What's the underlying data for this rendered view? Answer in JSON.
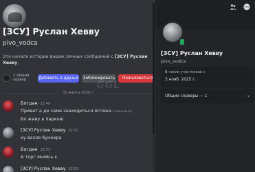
{
  "chat": {
    "title": "[ЗСУ] Руслан Хевву",
    "username": "pivo_vodca",
    "intro_prefix": "Это начало истории ваших личных сообщений с ",
    "intro_name": "[ЗСУ] Руслан Хевву",
    "intro_suffix": ".",
    "mutual_servers": "1 общий сервер",
    "buttons": {
      "add_friend": "Добавить в друзья",
      "block": "Заблокировать",
      "report": "Пожаловаться на"
    },
    "date_divider": "31 марта 2026 г.",
    "messages": [
      {
        "author": "Богдан",
        "time": "22:49",
        "lines": [
          "Приват а де саме знаходиться Аптека",
          "Бо живу в Харкові"
        ],
        "edited": "(изменено)"
      },
      {
        "author": "[ЗСУ] Руслан Хевву",
        "time": "22:52",
        "lines": [
          "ку возле бункера"
        ]
      },
      {
        "author": "Богдан",
        "time": "22:53",
        "lines": [
          "А торг якийсь є"
        ]
      },
      {
        "author": "[ЗСУ] Руслан Хевву",
        "time": "22:53",
        "lines": []
      }
    ]
  },
  "watermark": "GGL",
  "profile": {
    "name": "[ЗСУ] Руслан Хевву",
    "username": "pivo_vodca",
    "member_since_label": "В числе участников с",
    "member_since_value": "3 нояб. 2025 г.",
    "mutual_servers_label": "Общие серверы — 1"
  },
  "colors": {
    "accent": "#5865f2",
    "danger": "#da373c",
    "online": "#23a55a",
    "background": "#313338",
    "panel": "#232428"
  },
  "icons": [
    "people-icon",
    "more-icon",
    "server-icon",
    "chevron-right-icon"
  ]
}
